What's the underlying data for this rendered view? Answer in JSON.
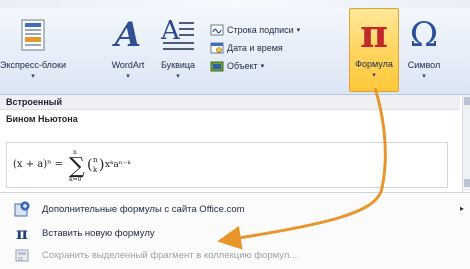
{
  "ribbon": {
    "quickparts_label": "Экспресс-блоки",
    "wordart_label": "WordArt",
    "dropcap_label": "Буквица",
    "signature_line_label": "Строка подписи",
    "datetime_label": "Дата и время",
    "object_label": "Объект",
    "equation_label": "Формула",
    "symbol_label": "Символ",
    "pi_glyph": "π",
    "omega_glyph": "Ω",
    "wordart_glyph": "A",
    "dropcap_glyph": "A",
    "caret": "▾"
  },
  "gallery": {
    "section_header": "Встроенный",
    "item_title": "Бином Ньютона"
  },
  "menu": {
    "items": [
      {
        "label": "Дополнительные формулы с сайта Office.com",
        "icon": "office-com-icon"
      },
      {
        "label": "Вставить новую формулу",
        "icon": "pi-icon",
        "glyph": "π"
      },
      {
        "label": "Сохранить выделенный фрагмент в коллекцию формул...",
        "icon": "save-selection-icon"
      }
    ],
    "submenu_arrow": "▸"
  },
  "colors": {
    "active_button": "#ffd766",
    "annotation_arrow": "#e8962a",
    "pi_red": "#c0282b",
    "omega_blue": "#2a4f9e"
  }
}
